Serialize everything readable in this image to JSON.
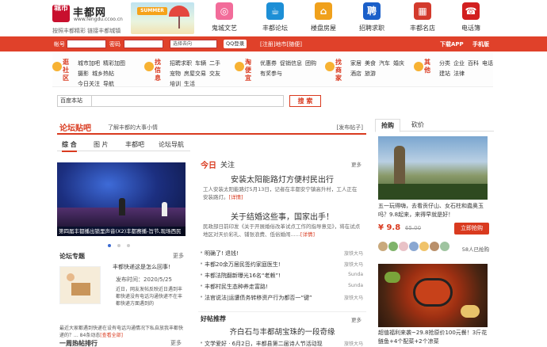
{
  "header": {
    "logo_seal": "城市",
    "logo_name": "丰都网",
    "logo_domain": "www.fengdu.ccoo.cn",
    "logo_slogan": "按照丰都精彩  链接丰都城镇",
    "banner_text": "SUMMER",
    "nav": [
      {
        "label": "鬼城文艺",
        "icon": "donut-icon",
        "color": "#f26c9a",
        "glyph": "◎"
      },
      {
        "label": "丰都论坛",
        "icon": "coffee-cup-icon",
        "color": "#1d8fd6",
        "glyph": "☕"
      },
      {
        "label": "楼盘房屋",
        "icon": "house-icon",
        "color": "#f0a11c",
        "glyph": "⌂"
      },
      {
        "label": "招聘求职",
        "icon": "recruit-icon",
        "color": "#1a5fc9",
        "glyph": "聘"
      },
      {
        "label": "丰都名店",
        "icon": "shop-icon",
        "color": "#d33a2c",
        "glyph": "▦"
      },
      {
        "label": "电话簿",
        "icon": "phone-book-icon",
        "color": "#d21f1f",
        "glyph": "☎"
      }
    ]
  },
  "loginbar": {
    "account_label": "帐号",
    "password_label": "密码",
    "select_value": "选择去向",
    "qq_label": "QQ登录",
    "register_text": "[注册]地市[随便]",
    "download_label": "下载APP",
    "mobile_label": "手机版"
  },
  "categories": [
    {
      "name": "逛社区",
      "links": [
        "城市加吧",
        "精彩加图",
        "摄影",
        "城乡热帖",
        "今日关注",
        "导航"
      ]
    },
    {
      "name": "找信息",
      "links": [
        "招聘求职",
        "车辆",
        "二手",
        "宠物",
        "房屋交易",
        "交友",
        "培训",
        "生活"
      ]
    },
    {
      "name": "淘便宜",
      "links": [
        "优惠券",
        "促销信息",
        "团购",
        "有奖参与"
      ]
    },
    {
      "name": "找商家",
      "links": [
        "家居",
        "美食",
        "汽车",
        "婚庆",
        "酒店",
        "旅游"
      ]
    },
    {
      "name": "其他",
      "links": [
        "分类",
        "企业",
        "百科",
        "电话",
        "建站",
        "法律"
      ]
    }
  ],
  "search": {
    "scope": "百度本站",
    "button": "搜 索"
  },
  "forum": {
    "title": "论坛贴吧",
    "subtitle": "了解丰都的大事小情",
    "post_link": "[发布帖子]",
    "tabs": [
      "综 合",
      "图 片",
      "丰都吧",
      "论坛导航"
    ],
    "photo_caption": "第四届丰都播出锁里声音(X2)丰都赛播-旨节,现场西民",
    "topic_title": "论坛专题",
    "more": "更多",
    "topic_headline": "丰都快递这是怎么回事!",
    "topic_date": "发布时间：2020/5/25",
    "topic_desc": "近日，网友发帖反映近日遇到丰都快递没有电话沟通快递不在丰都快递方面遇到的",
    "topic_bottom_pre": "最近大家都遇到快递在设有电话沟通情况下私自放我丰都快递的？... 84条动态",
    "topic_bottom_link": "[查看全部]",
    "hot_week": "一周热帖排行",
    "hot_more": "更多"
  },
  "today": {
    "tag": "今日",
    "tag2": "关注",
    "more": "更多",
    "headline1": "安装太阳能路灯方便村民出行",
    "summary1": "工人安装太阳能路灯5月13日，记者在丰都安宁镇高升村，工人正在安装路灯。",
    "summary1_link": "[详情]",
    "headline2": "关于结婚这些事，国家出手！",
    "summary2": "民政部日前印发《关于开展婚俗改革试点工作的指导意见》，将在试点地区对天价彩礼、铺张浪费、低俗婚闹......",
    "summary2_link": "[详情]",
    "news": [
      {
        "title": "明确了! 退钱!",
        "author": "旅铁大马"
      },
      {
        "title": "丰都20余万居民签约家庭医生!",
        "author": "旅铁大马"
      },
      {
        "title": "丰都法院翻新曝光16名“老赖”!",
        "author": "Sunda"
      },
      {
        "title": "丰都村民生态种养走富路!",
        "author": "Sunda"
      },
      {
        "title": "法官说法|运遭债务转移资产行为都否一“键”",
        "author": "旅铁大马"
      }
    ],
    "good_title": "好帖推荐",
    "good_more": "更多",
    "good_headline": "齐白石与丰都胡宝珠的一段奇缘",
    "good_item": "文学爱好 · 6月2日，丰都县第二届诗人节活动现",
    "good_author": "旅铁大马"
  },
  "shop": {
    "tabs": [
      "抢购",
      "砍价"
    ],
    "desc1": "五一玩得嗨，去看贡仔山、女石柱和蠹奥玉吗？9.8起来，来得早就是好！",
    "price": "¥ 9.8",
    "old_price": "65.00",
    "buy": "立即抢购",
    "bought": "58人已抢购",
    "desc2": "超值福利来袭~29.8抢原价100元餐！3斤花鲢鱼+4个配菜+2个凉菜"
  }
}
